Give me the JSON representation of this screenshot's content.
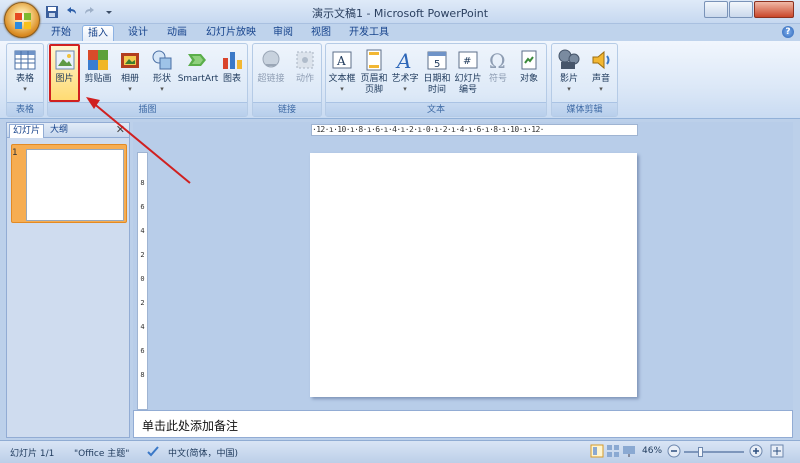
{
  "window": {
    "title": "演示文稿1 - Microsoft PowerPoint"
  },
  "tabs": [
    "开始",
    "插入",
    "设计",
    "动画",
    "幻灯片放映",
    "审阅",
    "视图",
    "开发工具"
  ],
  "active_tab": "插入",
  "ribbon": {
    "groups": [
      {
        "label": "表格",
        "buttons": [
          {
            "label": "表格",
            "icon": "table-icon"
          }
        ]
      },
      {
        "label": "插图",
        "buttons": [
          {
            "label": "图片",
            "icon": "picture-icon"
          },
          {
            "label": "剪贴画",
            "icon": "clipart-icon"
          },
          {
            "label": "相册",
            "icon": "photo-album-icon"
          },
          {
            "label": "形状",
            "icon": "shapes-icon"
          },
          {
            "label": "SmartArt",
            "icon": "smartart-icon"
          },
          {
            "label": "图表",
            "icon": "chart-icon"
          }
        ]
      },
      {
        "label": "链接",
        "buttons": [
          {
            "label": "超链接",
            "icon": "hyperlink-icon"
          },
          {
            "label": "动作",
            "icon": "action-icon"
          }
        ]
      },
      {
        "label": "文本",
        "buttons": [
          {
            "label": "文本框",
            "icon": "textbox-icon"
          },
          {
            "label": "页眉和页脚",
            "icon": "header-footer-icon"
          },
          {
            "label": "艺术字",
            "icon": "wordart-icon"
          },
          {
            "label": "日期和时间",
            "icon": "datetime-icon"
          },
          {
            "label": "幻灯片编号",
            "icon": "slide-number-icon"
          },
          {
            "label": "符号",
            "icon": "symbol-icon"
          },
          {
            "label": "对象",
            "icon": "object-icon"
          }
        ]
      },
      {
        "label": "媒体剪辑",
        "buttons": [
          {
            "label": "影片",
            "icon": "movie-icon"
          },
          {
            "label": "声音",
            "icon": "sound-icon"
          }
        ]
      }
    ],
    "labels": {
      "table": "表格",
      "table_group": "表格",
      "picture_1": "图",
      "picture_2": "片",
      "clipart_1": "剪贴画",
      "album": "相册",
      "shapes": "形状",
      "smartart": "SmartArt",
      "chart": "图表",
      "illus_group": "插图",
      "hyperlink": "超链接",
      "action": "动作",
      "link_group": "链接",
      "textbox": "文本框",
      "hf_1": "页眉和",
      "hf_2": "页脚",
      "wordart": "艺术字",
      "dt_1": "日期和",
      "dt_2": "时间",
      "sn_1": "幻灯片",
      "sn_2": "编号",
      "symbol": "符号",
      "object": "对象",
      "text_group": "文本",
      "movie": "影片",
      "sound": "声音",
      "media_group": "媒体剪辑"
    }
  },
  "left_pane": {
    "tabs": [
      "幻灯片",
      "大纲"
    ],
    "slide_number": "1"
  },
  "rulers": {
    "horizontal": "·12·ı·10·ı·8·ı·6·ı·4·ı·2·ı·0·ı·2·ı·4·ı·6·ı·8·ı·10·ı·12·",
    "vertical": [
      "8",
      "6",
      "4",
      "2",
      "0",
      "2",
      "4",
      "6",
      "8"
    ]
  },
  "notes": {
    "placeholder": "单击此处添加备注"
  },
  "status": {
    "slide": "幻灯片 1/1",
    "theme": "\"Office 主题\"",
    "language": "中文(简体，中国)",
    "zoom": "46%"
  },
  "colors": {
    "accent": "#d02020",
    "ribbon": "#dce8f7",
    "work_area": "#b8cde9"
  }
}
